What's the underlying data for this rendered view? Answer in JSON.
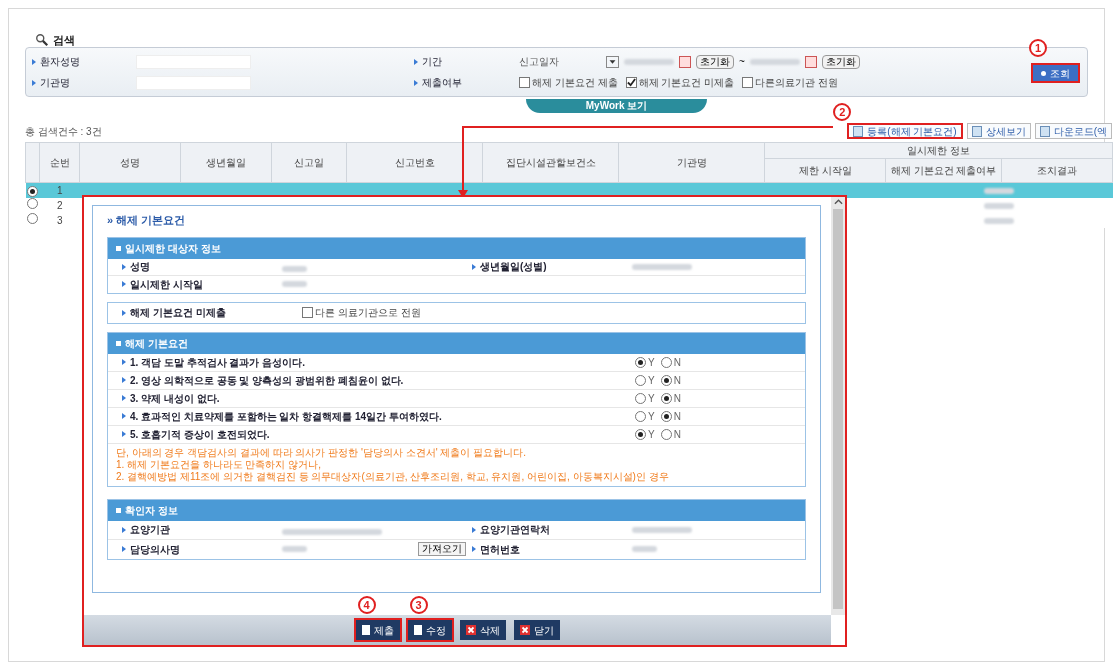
{
  "search": {
    "title": "검색",
    "fields": [
      {
        "label": "환자성명"
      },
      {
        "label": "기관명"
      }
    ],
    "period": {
      "label": "기간",
      "select": "신고일자",
      "resets": [
        "초기화",
        "초기화"
      ],
      "separator": "~"
    },
    "submission": {
      "label": "제출여부",
      "options": [
        {
          "label": "해제 기본요건 제출",
          "checked": false
        },
        {
          "label": "해제 기본요건 미제출",
          "checked": true
        },
        {
          "label": "다른의료기관 전원",
          "checked": false
        }
      ]
    },
    "button": {
      "label": "조회",
      "marker": "1"
    }
  },
  "tab": "MyWork 보기",
  "total": "총 검색건수 : 3건",
  "actions": [
    {
      "label": "등록(해제 기본요건)",
      "marker": "2"
    },
    {
      "label": "상세보기"
    },
    {
      "label": "다운로드(엑"
    }
  ],
  "table": {
    "columns": [
      "순번",
      "성명",
      "생년월일",
      "신고일",
      "신고번호",
      "집단시설관할보건소",
      "기관명"
    ],
    "group": "일시제한 정보",
    "sub_columns": [
      "제한 시작일",
      "해제 기본요건 제출여부",
      "조치결과"
    ],
    "rows": [
      {
        "no": "1",
        "selected": true
      },
      {
        "no": "2",
        "selected": false
      },
      {
        "no": "3",
        "selected": false
      }
    ]
  },
  "modal": {
    "title": "» 해제 기본요건",
    "target": {
      "title": "일시제한 대상자 정보",
      "labels": [
        "성명",
        "생년월일(성별)",
        "일시제한 시작일"
      ]
    },
    "unsubmitted": {
      "label": "해제 기본요건 미제출",
      "option": {
        "label": "다른 의료기관으로 전원",
        "checked": false
      }
    },
    "criteria": {
      "title": "해제 기본요건",
      "items": [
        {
          "text": "1. 객담 도말 추적검사 결과가 음성이다.",
          "options": [
            {
              "label": "Y",
              "selected": true
            },
            {
              "label": "N",
              "selected": false
            }
          ]
        },
        {
          "text": "2. 영상 의학적으로 공동 및 양측성의 광범위한 폐침윤이 없다.",
          "options": [
            {
              "label": "Y",
              "selected": false
            },
            {
              "label": "N",
              "selected": true
            }
          ]
        },
        {
          "text": "3. 약제 내성이 없다.",
          "options": [
            {
              "label": "Y",
              "selected": false
            },
            {
              "label": "N",
              "selected": true
            }
          ]
        },
        {
          "text": "4. 효과적인 치료약제를 포함하는 일차 항결핵제를 14일간 투여하였다.",
          "options": [
            {
              "label": "Y",
              "selected": false
            },
            {
              "label": "N",
              "selected": true
            }
          ]
        },
        {
          "text": "5. 호흡기적 증상이 호전되었다.",
          "options": [
            {
              "label": "Y",
              "selected": true
            },
            {
              "label": "N",
              "selected": false
            }
          ]
        }
      ],
      "notes": [
        "단, 아래의 경우 객담검사의 결과에 따라 의사가 판정한 '담당의사 소견서' 제출이 필요합니다.",
        "1. 해제 기본요건을 하나라도 만족하지 않거나,",
        "2. 결핵예방법 제11조에 의거한 결핵검진 등 의무대상자(의료기관, 산후조리원, 학교, 유치원, 어린이집, 아동복지시설)인 경우"
      ]
    },
    "confirmer": {
      "title": "확인자 정보",
      "labels": [
        "요양기관",
        "요양기관연락처",
        "담당의사명",
        "면허번호"
      ],
      "fetch": "가져오기"
    },
    "buttons": [
      {
        "label": "제출",
        "kind": "doc",
        "marker": "4"
      },
      {
        "label": "수정",
        "kind": "doc",
        "marker": "3"
      },
      {
        "label": "삭제",
        "kind": "x"
      },
      {
        "label": "닫기",
        "kind": "x"
      }
    ]
  }
}
